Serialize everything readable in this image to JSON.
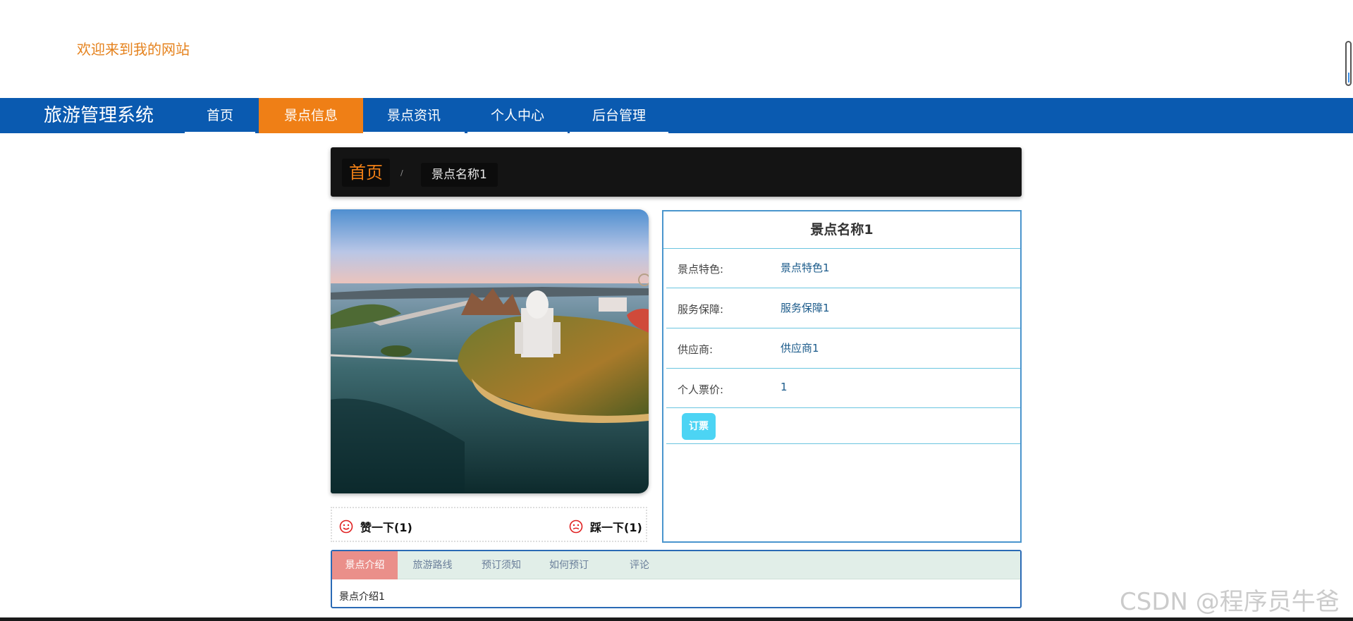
{
  "header": {
    "welcome_text": "欢迎来到我的网站"
  },
  "navbar": {
    "brand": "旅游管理系统",
    "items": [
      {
        "label": "首页"
      },
      {
        "label": "景点信息",
        "active": true
      },
      {
        "label": "景点资讯"
      },
      {
        "label": "个人中心"
      },
      {
        "label": "后台管理"
      }
    ],
    "colors": {
      "background": "#0a5ab0",
      "active": "#ef7f16"
    }
  },
  "breadcrumb": {
    "home": "首页",
    "separator": "/",
    "current": "景点名称1"
  },
  "votes": {
    "like_label": "赞一下(1)",
    "dislike_label": "踩一下(1)",
    "icon": "smile-icon"
  },
  "info": {
    "title": "景点名称1",
    "rows": [
      {
        "label": "景点特色:",
        "value": "景点特色1"
      },
      {
        "label": "服务保障:",
        "value": "服务保障1"
      },
      {
        "label": "供应商:",
        "value": "供应商1"
      },
      {
        "label": "个人票价:",
        "value": "1"
      }
    ],
    "book_button": "订票"
  },
  "tabs": {
    "items": [
      {
        "label": "景点介绍",
        "active": true
      },
      {
        "label": "旅游路线"
      },
      {
        "label": "预订须知"
      },
      {
        "label": "如何预订"
      },
      {
        "label": "评论"
      }
    ],
    "content": "景点介绍1"
  },
  "watermark": "CSDN @程序员牛爸"
}
